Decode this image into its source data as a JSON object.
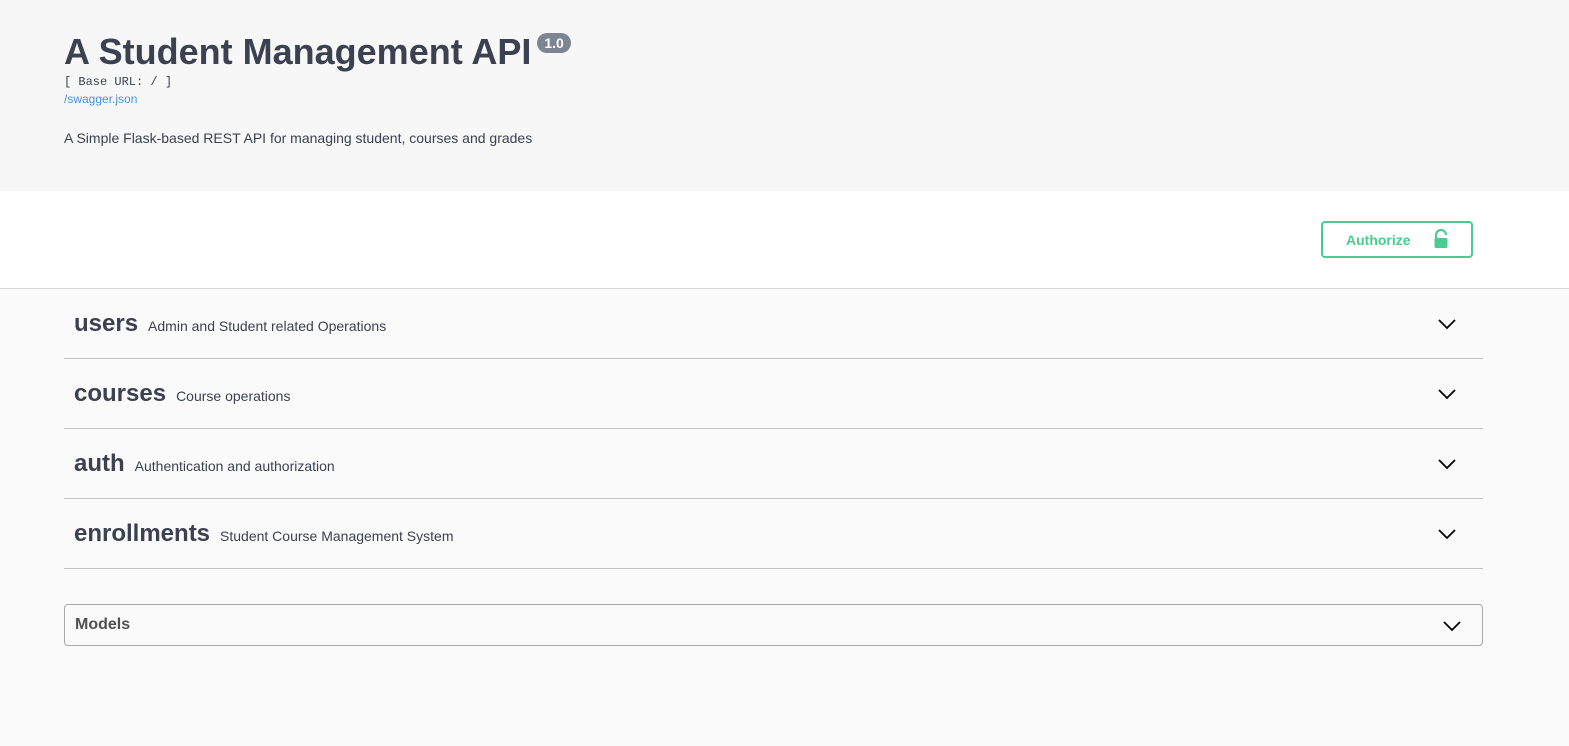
{
  "info": {
    "title": "A Student Management API",
    "version": "1.0",
    "base_url": "[ Base URL: / ]",
    "spec_link": "/swagger.json",
    "description": "A Simple Flask-based REST API for managing student, courses and grades"
  },
  "auth": {
    "authorize_label": "Authorize",
    "icon": "lock-open-icon",
    "color": "#49cc90"
  },
  "tags": [
    {
      "name": "users",
      "description": "Admin and Student related Operations"
    },
    {
      "name": "courses",
      "description": "Course operations"
    },
    {
      "name": "auth",
      "description": "Authentication and authorization"
    },
    {
      "name": "enrollments",
      "description": "Student Course Management System"
    }
  ],
  "models": {
    "title": "Models"
  },
  "colors": {
    "text": "#3b4151",
    "version_badge": "#7d8492",
    "link": "#4990e2"
  }
}
